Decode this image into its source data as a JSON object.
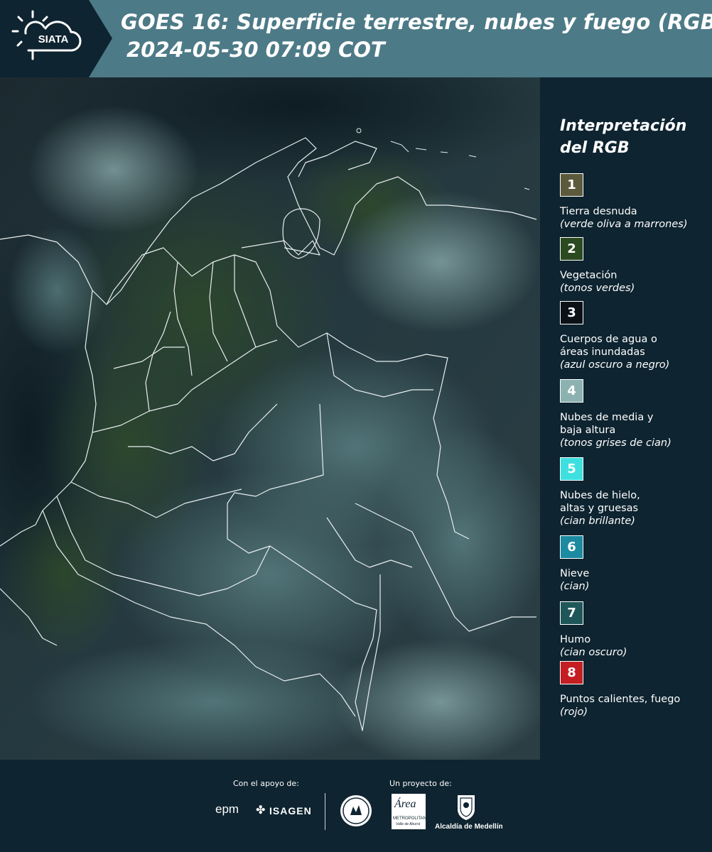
{
  "header": {
    "logo_text": "SIATA",
    "title_line1": "GOES 16: Superficie terrestre, nubes y fuego (RGB)",
    "title_line2": "2024-05-30 07:09 COT"
  },
  "legend": {
    "title": "Interpretación del RGB",
    "items": [
      {
        "number": "1",
        "label": "Tierra desnuda",
        "sub": "(verde oliva a marrones)",
        "color": "#5c5a3c"
      },
      {
        "number": "2",
        "label": "Vegetación",
        "sub": "(tonos verdes)",
        "color": "#2b4a1f"
      },
      {
        "number": "3",
        "label": "Cuerpos de agua o\náreas inundadas",
        "sub": "(azul oscuro a negro)",
        "color": "#0b1217"
      },
      {
        "number": "4",
        "label": "Nubes de media y\nbaja altura",
        "sub": "(tonos grises de cian)",
        "color": "#8bb2b0"
      },
      {
        "number": "5",
        "label": "Nubes de hielo,\naltas y gruesas",
        "sub": "(cian brillante)",
        "color": "#3ee0df"
      },
      {
        "number": "6",
        "label": "Nieve",
        "sub": "(cian)",
        "color": "#1c8aa0"
      },
      {
        "number": "7",
        "label": "Humo",
        "sub": "(cian oscuro)",
        "color": "#1f5659"
      },
      {
        "number": "8",
        "label": "Puntos calientes, fuego",
        "sub": "(rojo)",
        "color": "#c41d22"
      }
    ]
  },
  "footer": {
    "support_label": "Con el apoyo de:",
    "project_label": "Un proyecto de:",
    "sponsors": {
      "epm": "epm",
      "isagen": "ISAGEN",
      "area_metropolitana": "Área",
      "area_metropolitana_sub": "METROPOLITANA",
      "area_metropolitana_sub2": "Valle de Aburrá",
      "alcaldia": "Alcaldía de Medellín"
    }
  },
  "colors": {
    "header_bg": "#4d7a87",
    "panel_bg": "#0e2430",
    "logo_bg": "#0e2430"
  }
}
